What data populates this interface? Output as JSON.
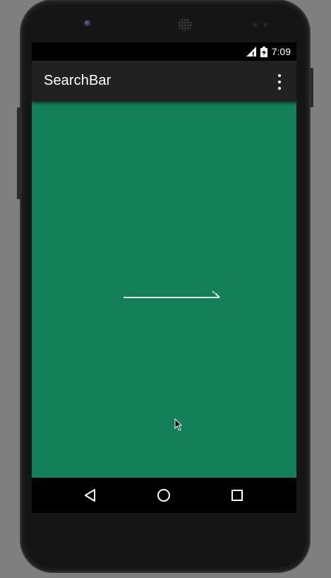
{
  "status_bar": {
    "time": "7:09",
    "icons": [
      "signal-icon",
      "battery-charging-icon"
    ]
  },
  "toolbar": {
    "title": "SearchBar",
    "overflow_icon": "more-vert-icon"
  },
  "content": {
    "background_color": "#13805a",
    "widget_icon": "collapsed-search-bar-line"
  },
  "nav_bar": {
    "buttons": [
      "back-icon",
      "home-icon",
      "recents-icon"
    ]
  },
  "colors": {
    "toolbar": "#212121",
    "content": "#13805a",
    "status_bar": "#000000",
    "nav_bar": "#000000"
  }
}
